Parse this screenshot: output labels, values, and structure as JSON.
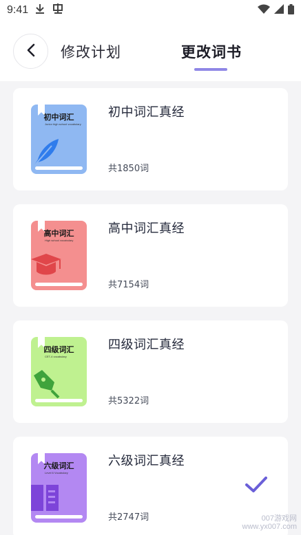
{
  "status_bar": {
    "time": "9:41"
  },
  "header": {
    "tab_plan": "修改计划",
    "tab_book": "更改词书",
    "active_tab": "更改词书"
  },
  "books": [
    {
      "title": "初中词汇真经",
      "count": "共1850词",
      "cover_title": "初中词汇",
      "cover_sub": "Junior high school vocabulary",
      "cover_color": "#8fb8f2",
      "emblem_color": "#2f7cec",
      "emblem": "feather-icon",
      "selected": false
    },
    {
      "title": "高中词汇真经",
      "count": "共7154词",
      "cover_title": "高中词汇",
      "cover_sub": "High school vocabulary",
      "cover_color": "#f48f8f",
      "emblem_color": "#e0464a",
      "emblem": "graduation-cap-icon",
      "selected": false
    },
    {
      "title": "四级词汇真经",
      "count": "共5322词",
      "cover_title": "四级词汇",
      "cover_sub": "CET-4 vocabulary",
      "cover_color": "#bff190",
      "emblem_color": "#3fa33c",
      "emblem": "pen-nib-icon",
      "selected": false
    },
    {
      "title": "六级词汇真经",
      "count": "共2747词",
      "cover_title": "六级词汇",
      "cover_sub": "Level 6 Vocabulary",
      "cover_color": "#b388f2",
      "emblem_color": "#7d44d9",
      "emblem": "book-icon",
      "selected": true
    }
  ],
  "watermark": {
    "line1": "007游戏网",
    "line2": "www.yx007.com"
  },
  "colors": {
    "accent": "#8f87e6",
    "check": "#6a5fd8",
    "background": "#f4f4f6"
  }
}
